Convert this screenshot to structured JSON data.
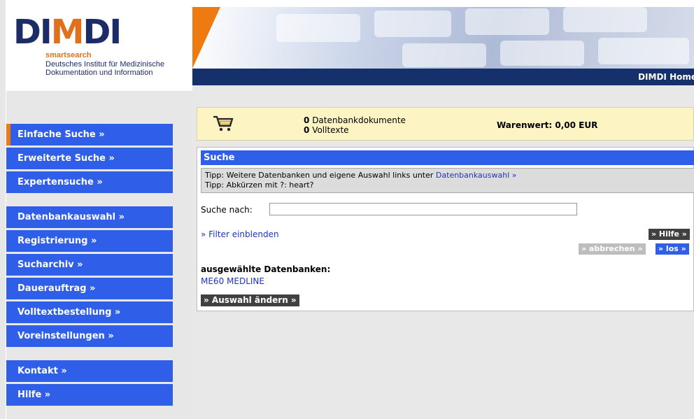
{
  "logo": {
    "mark": "DIMDI",
    "tagline": "smartsearch",
    "institute_line1": "Deutsches Institut für Medizinische",
    "institute_line2": "Dokumentation und Information"
  },
  "header": {
    "home_link": "DIMDI Home"
  },
  "nav": {
    "group1": [
      {
        "label": "Einfache Suche »",
        "active": true
      },
      {
        "label": "Erweiterte Suche »"
      },
      {
        "label": "Expertensuche »"
      }
    ],
    "group2": [
      {
        "label": "Datenbankauswahl »"
      },
      {
        "label": "Registrierung »"
      },
      {
        "label": "Sucharchiv »"
      },
      {
        "label": "Dauerauftrag »"
      },
      {
        "label": "Volltextbestellung »"
      },
      {
        "label": "Voreinstellungen »"
      }
    ],
    "group3": [
      {
        "label": "Kontakt »"
      },
      {
        "label": "Hilfe »"
      }
    ]
  },
  "cart": {
    "icon": "shopping-cart-icon",
    "db_docs_count": "0",
    "db_docs_label": "Datenbankdokumente",
    "fulltext_count": "0",
    "fulltext_label": "Volltexte",
    "value_label": "Warenwert: 0,00 EUR"
  },
  "search": {
    "title": "Suche",
    "tip1_text": "Tipp: Weitere Datenbanken und eigene Auswahl links unter",
    "tip1_link": "Datenbankauswahl »",
    "tip2_text": "Tipp: Abkürzen mit ?: heart?",
    "label": "Suche nach:",
    "value": "",
    "filter_link": "» Filter einblenden",
    "help_button": "» Hilfe »",
    "cancel_button": "» abbrechen »",
    "go_button": "» los »",
    "selected_label": "ausgewählte Datenbanken:",
    "selected_db": "ME60 MEDLINE",
    "change_button": "» Auswahl ändern »"
  },
  "colors": {
    "nav_blue": "#2f5fe8",
    "accent_orange": "#f07a12",
    "header_navy": "#16306b",
    "cart_yellow": "#fdf4c3"
  }
}
